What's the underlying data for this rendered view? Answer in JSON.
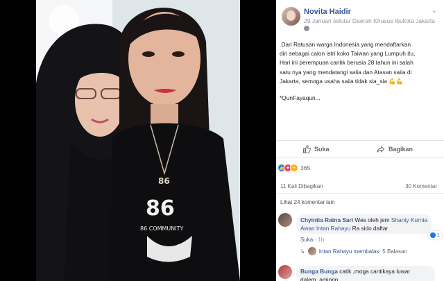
{
  "post": {
    "author": "Novita Haidir",
    "meta": "29 Januari  selutar Daerah Khusus Ibukota Jakarta ·",
    "text_lines": [
      ".Dari Ratusan warga Indonesia yang mendaftarkan",
      "diri sebagai calon istri koko Taiwan yang Lumpuh itu,",
      "Hari ini perempuan cantik berusia 28 tahun ini salah",
      "satu nya yang mendatangi saiia dan Atasan saiia di",
      "Jakarta, semoga usaha saiia tidak sia_sia 💪💪"
    ],
    "hashtag": "*QunFayaqun..."
  },
  "actions": {
    "like_label": "Suka",
    "share_label": "Bagikan"
  },
  "reactions": {
    "count": "365",
    "shares": "11 Kali Dibagikan",
    "comments": "30 Komentar"
  },
  "comments_section": {
    "more_label": "Lihat 24 komentar lain",
    "comment1": {
      "author": "Chyintia Ratna Sari",
      "text_before": " Wes oleh jem ",
      "tag": "Shanty Kurnia Awan Intan Rahayu",
      "text_after": " Ra sido daftar",
      "like_count": "1",
      "like_link": "Suka",
      "time": "1h",
      "reply_author": "Intan Rahayu membalas",
      "reply_count": "· 5 Balasan"
    },
    "comment2": {
      "author": "Bunga Bunga",
      "text": " catik ,moga cantikaya luwar dalem..aminnn"
    }
  },
  "colors": {
    "link": "#385898",
    "like_blue": "#1877f2",
    "love_red": "#f33e58",
    "wow_yellow": "#f7b125"
  },
  "photo": {
    "shirt_text": "86 COMMUNITY",
    "pendant_text": "86"
  }
}
